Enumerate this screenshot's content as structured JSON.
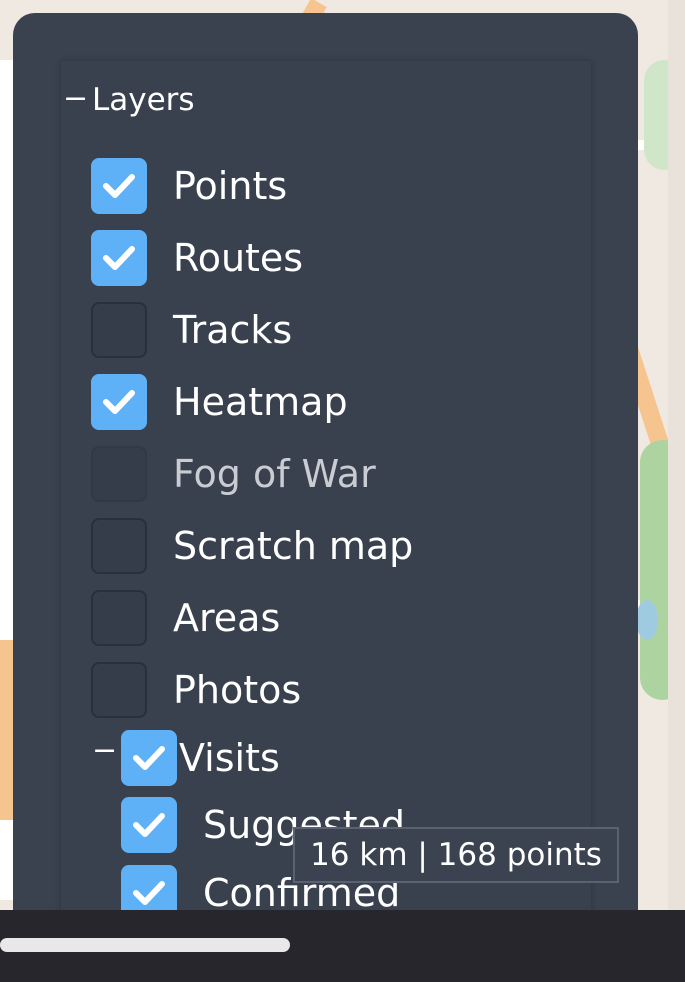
{
  "layers_panel": {
    "title": "Layers",
    "collapse_symbol": "−",
    "items": [
      {
        "label": "Points",
        "checked": true,
        "disabled": false
      },
      {
        "label": "Routes",
        "checked": true,
        "disabled": false
      },
      {
        "label": "Tracks",
        "checked": false,
        "disabled": false
      },
      {
        "label": "Heatmap",
        "checked": true,
        "disabled": false
      },
      {
        "label": "Fog of War",
        "checked": false,
        "disabled": true
      },
      {
        "label": "Scratch map",
        "checked": false,
        "disabled": false
      },
      {
        "label": "Areas",
        "checked": false,
        "disabled": false
      },
      {
        "label": "Photos",
        "checked": false,
        "disabled": false
      }
    ],
    "visits": {
      "label": "Visits",
      "collapse_symbol": "−",
      "checked": true,
      "children": [
        {
          "label": "Suggested",
          "checked": true
        },
        {
          "label": "Confirmed",
          "checked": true
        }
      ]
    }
  },
  "tooltip": {
    "text": "16 km | 168 points"
  },
  "colors": {
    "accent": "#5fb1f7",
    "panel_bg": "#3a4250"
  }
}
